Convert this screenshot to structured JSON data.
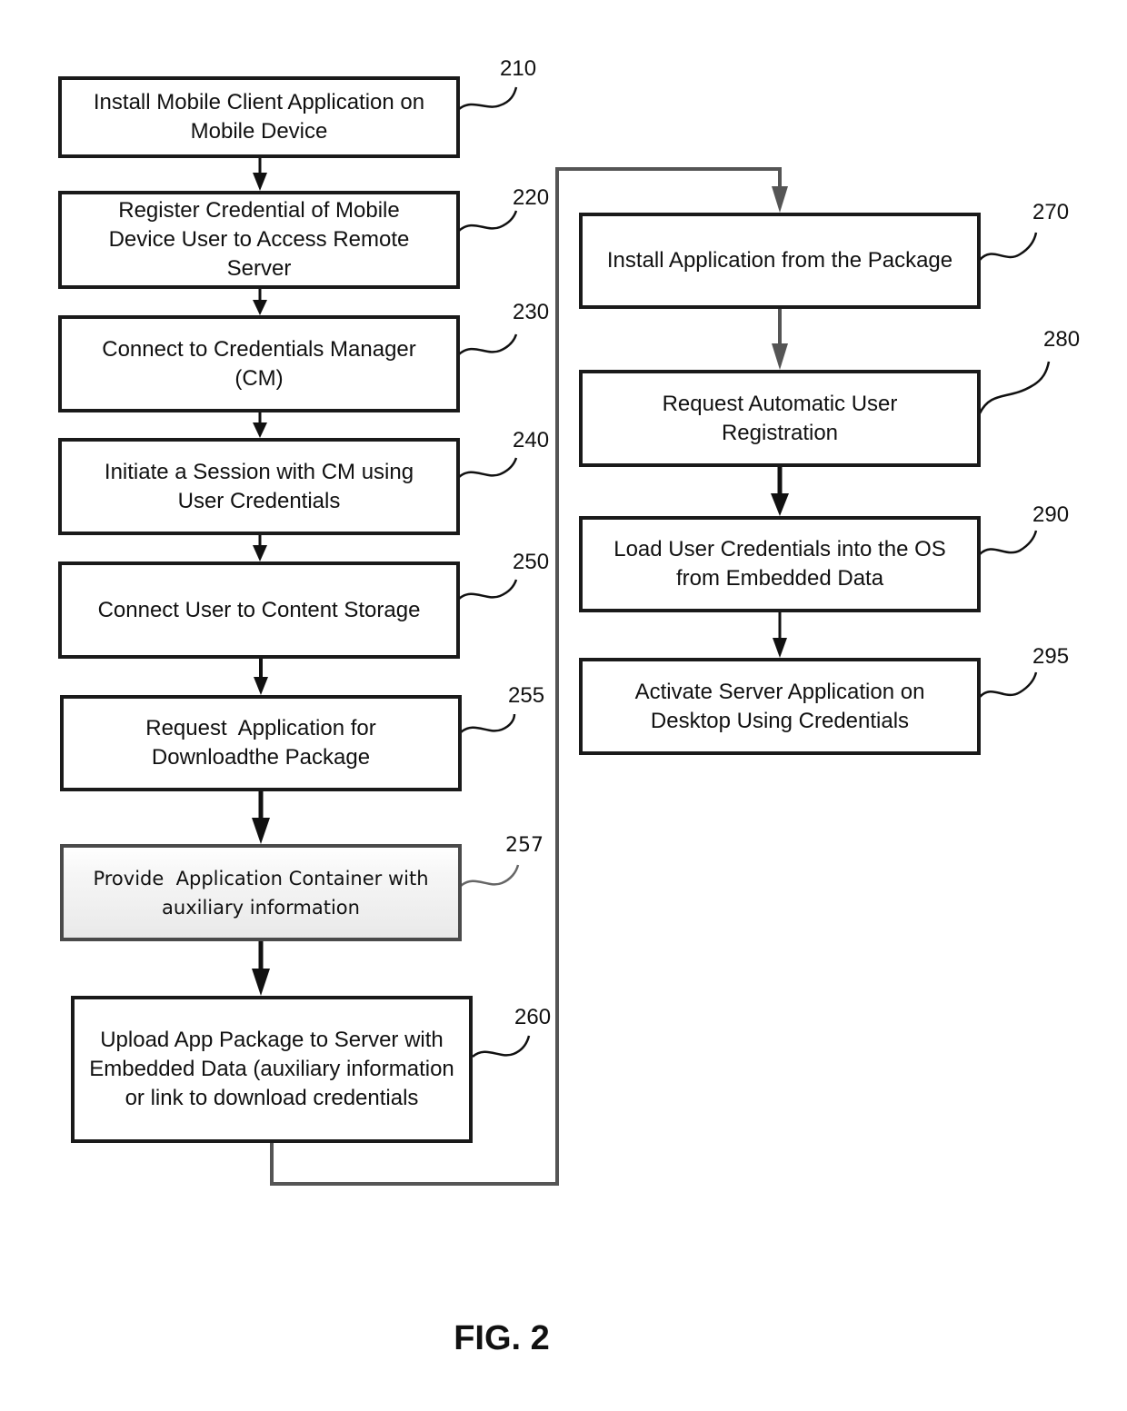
{
  "figure": {
    "label": "FIG. 2"
  },
  "steps": [
    {
      "ref": "210",
      "text": "Install Mobile Client Application on Mobile Device"
    },
    {
      "ref": "220",
      "text": "Register Credential of Mobile Device User to Access Remote Server"
    },
    {
      "ref": "230",
      "text": "Connect to Credentials Manager (CM)"
    },
    {
      "ref": "240",
      "text": "Initiate a Session with CM using User Credentials"
    },
    {
      "ref": "250",
      "text": "Connect User to Content Storage"
    },
    {
      "ref": "255",
      "text": "Request  Application for Downloadthe Package"
    },
    {
      "ref": "257",
      "text": "Provide  Application Container with auxiliary information"
    },
    {
      "ref": "260",
      "text": "Upload App Package to Server with Embedded Data (auxiliary information or link to download credentials"
    },
    {
      "ref": "270",
      "text": "Install Application from the Package"
    },
    {
      "ref": "280",
      "text": "Request Automatic User Registration"
    },
    {
      "ref": "290",
      "text": "Load User Credentials into the OS from Embedded Data"
    },
    {
      "ref": "295",
      "text": "Activate Server Application on Desktop Using Credentials"
    }
  ],
  "flow": [
    [
      "210",
      "220"
    ],
    [
      "220",
      "230"
    ],
    [
      "230",
      "240"
    ],
    [
      "240",
      "250"
    ],
    [
      "250",
      "255"
    ],
    [
      "255",
      "257"
    ],
    [
      "257",
      "260"
    ],
    [
      "260",
      "270"
    ],
    [
      "270",
      "280"
    ],
    [
      "280",
      "290"
    ],
    [
      "290",
      "295"
    ]
  ]
}
